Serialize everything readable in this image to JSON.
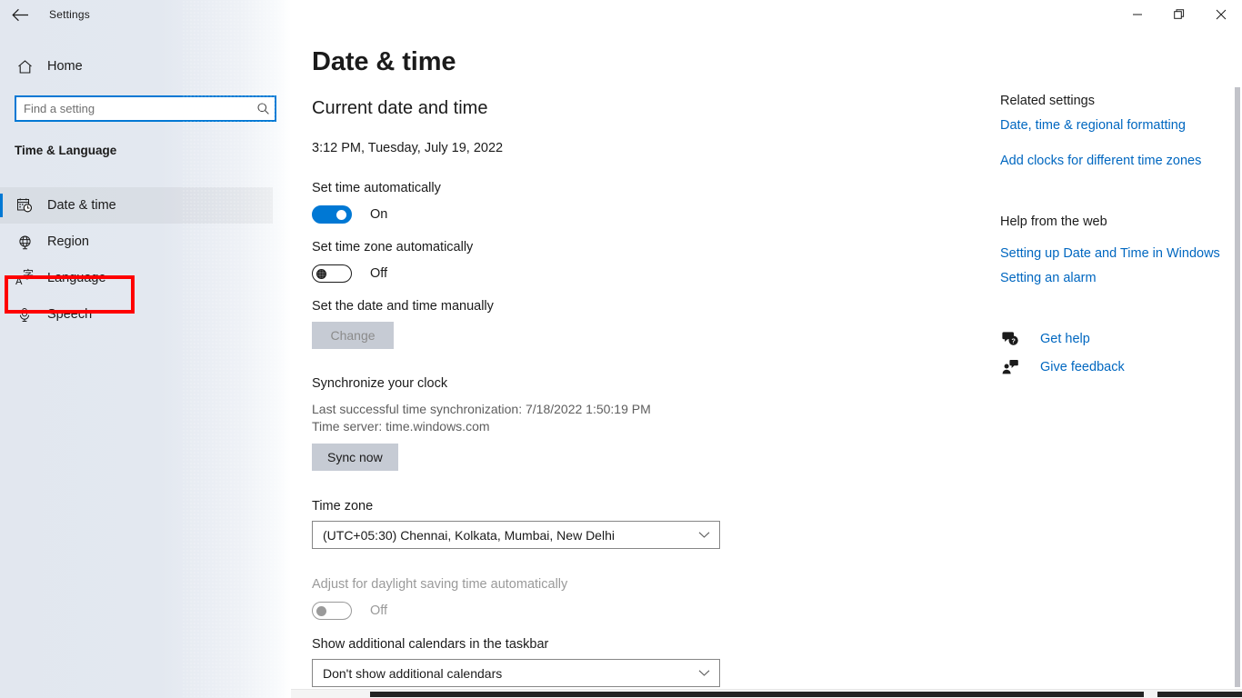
{
  "window": {
    "title": "Settings",
    "back_label": "Back",
    "controls": {
      "minimize": "Minimize",
      "restore": "Restore",
      "close": "Close"
    }
  },
  "sidebar": {
    "home_label": "Home",
    "search": {
      "placeholder": "Find a setting",
      "value": ""
    },
    "group_header": "Time & Language",
    "items": [
      {
        "label": "Date & time",
        "icon": "calendar-clock-icon",
        "selected": true
      },
      {
        "label": "Region",
        "icon": "globe-icon",
        "selected": false
      },
      {
        "label": "Language",
        "icon": "language-icon",
        "selected": false,
        "highlighted": true
      },
      {
        "label": "Speech",
        "icon": "microphone-icon",
        "selected": false
      }
    ],
    "highlight_color": "#ff0000"
  },
  "main": {
    "page_title": "Date & time",
    "current_section_title": "Current date and time",
    "current_datetime": "3:12 PM, Tuesday, July 19, 2022",
    "set_time_auto": {
      "label": "Set time automatically",
      "state": "On"
    },
    "set_timezone_auto": {
      "label": "Set time zone automatically",
      "state": "Off"
    },
    "set_manually": {
      "label": "Set the date and time manually",
      "button": "Change",
      "disabled": true
    },
    "sync": {
      "title": "Synchronize your clock",
      "last_sync": "Last successful time synchronization: 7/18/2022 1:50:19 PM",
      "time_server": "Time server: time.windows.com",
      "button": "Sync now"
    },
    "time_zone": {
      "label": "Time zone",
      "value": "(UTC+05:30) Chennai, Kolkata, Mumbai, New Delhi"
    },
    "daylight_saving": {
      "label": "Adjust for daylight saving time automatically",
      "state": "Off",
      "disabled": true
    },
    "additional_calendars": {
      "label": "Show additional calendars in the taskbar",
      "value": "Don't show additional calendars"
    }
  },
  "rail": {
    "related_settings_header": "Related settings",
    "related_links": [
      "Date, time & regional formatting",
      "Add clocks for different time zones"
    ],
    "help_header": "Help from the web",
    "help_links": [
      "Setting up Date and Time in Windows",
      "Setting an alarm"
    ],
    "support_links": [
      {
        "label": "Get help",
        "icon": "help-bubble-icon"
      },
      {
        "label": "Give feedback",
        "icon": "feedback-person-icon"
      }
    ],
    "link_color": "#0067c0"
  }
}
